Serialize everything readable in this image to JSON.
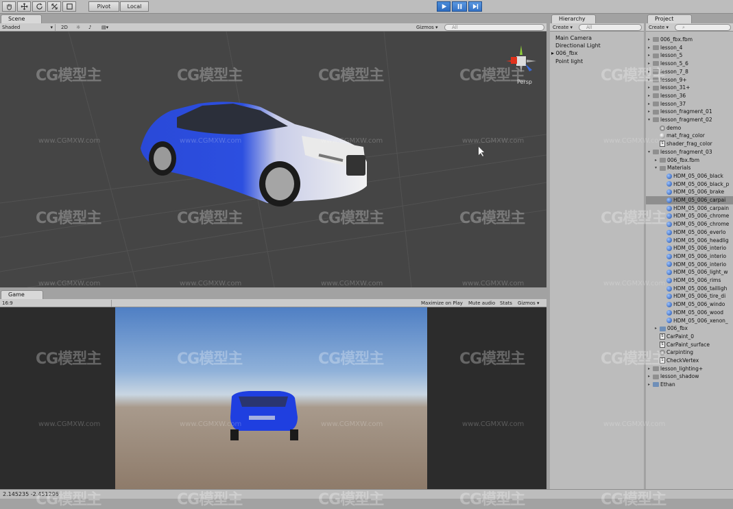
{
  "toolbar": {
    "pivot_label": "Pivot",
    "local_label": "Local"
  },
  "scene": {
    "tab_label": "Scene",
    "shading_mode": "Shaded",
    "mode_2d": "2D",
    "gizmos_label": "Gizmos",
    "search_placeholder": "All",
    "persp_label": "Persp"
  },
  "game": {
    "tab_label": "Game",
    "aspect": "16:9",
    "maximize_label": "Maximize on Play",
    "mute_label": "Mute audio",
    "stats_label": "Stats",
    "gizmos_label": "Gizmos"
  },
  "hierarchy": {
    "tab_label": "Hierarchy",
    "create_label": "Create",
    "search_placeholder": "All",
    "items": [
      "Main Camera",
      "Directional Light",
      "006_fbx",
      "Point light"
    ]
  },
  "project": {
    "tab_label": "Project",
    "create_label": "Create",
    "rows": [
      {
        "label": "006_fbx.fbm",
        "type": "folder",
        "indent": 0,
        "arrow": "right"
      },
      {
        "label": "lesson_4",
        "type": "folder",
        "indent": 0,
        "arrow": "right"
      },
      {
        "label": "lesson_5",
        "type": "folder",
        "indent": 0,
        "arrow": "right"
      },
      {
        "label": "lesson_5_6",
        "type": "folder",
        "indent": 0,
        "arrow": "right"
      },
      {
        "label": "lesson_7_8",
        "type": "folder",
        "indent": 0,
        "arrow": "right"
      },
      {
        "label": "lesson_9+",
        "type": "folder",
        "indent": 0,
        "arrow": "right"
      },
      {
        "label": "lesson_31+",
        "type": "folder",
        "indent": 0,
        "arrow": "right"
      },
      {
        "label": "lesson_36",
        "type": "folder",
        "indent": 0,
        "arrow": "right"
      },
      {
        "label": "lesson_37",
        "type": "folder",
        "indent": 0,
        "arrow": "right"
      },
      {
        "label": "lesson_fragment_01",
        "type": "folder",
        "indent": 0,
        "arrow": "right"
      },
      {
        "label": "lesson_fragment_02",
        "type": "folder",
        "indent": 0,
        "arrow": "down"
      },
      {
        "label": "demo",
        "type": "scene",
        "indent": 1,
        "arrow": ""
      },
      {
        "label": "mat_frag_color",
        "type": "material",
        "indent": 1,
        "arrow": ""
      },
      {
        "label": "shader_frag_color",
        "type": "script",
        "indent": 1,
        "arrow": ""
      },
      {
        "label": "lesson_fragment_03",
        "type": "folder",
        "indent": 0,
        "arrow": "down"
      },
      {
        "label": "006_fbx.fbm",
        "type": "folder",
        "indent": 1,
        "arrow": "right"
      },
      {
        "label": "Materials",
        "type": "folder",
        "indent": 1,
        "arrow": "down"
      },
      {
        "label": "HDM_05_006_black",
        "type": "ball",
        "indent": 2,
        "arrow": ""
      },
      {
        "label": "HDM_05_006_black_p",
        "type": "ball",
        "indent": 2,
        "arrow": ""
      },
      {
        "label": "HDM_05_006_brake",
        "type": "ball",
        "indent": 2,
        "arrow": ""
      },
      {
        "label": "HDM_05_006_carpai",
        "type": "ball",
        "indent": 2,
        "arrow": "",
        "selected": true
      },
      {
        "label": "HDM_05_006_carpain",
        "type": "ball",
        "indent": 2,
        "arrow": ""
      },
      {
        "label": "HDM_05_006_chrome",
        "type": "ball",
        "indent": 2,
        "arrow": ""
      },
      {
        "label": "HDM_05_006_chrome",
        "type": "ball",
        "indent": 2,
        "arrow": ""
      },
      {
        "label": "HDM_05_006_everlo",
        "type": "ball",
        "indent": 2,
        "arrow": ""
      },
      {
        "label": "HDM_05_006_headlig",
        "type": "ball",
        "indent": 2,
        "arrow": ""
      },
      {
        "label": "HDM_05_006_interio",
        "type": "ball",
        "indent": 2,
        "arrow": ""
      },
      {
        "label": "HDM_05_006_interio",
        "type": "ball",
        "indent": 2,
        "arrow": ""
      },
      {
        "label": "HDM_05_006_interio",
        "type": "ball",
        "indent": 2,
        "arrow": ""
      },
      {
        "label": "HDM_05_006_light_w",
        "type": "ball",
        "indent": 2,
        "arrow": ""
      },
      {
        "label": "HDM_05_006_rims",
        "type": "ball",
        "indent": 2,
        "arrow": ""
      },
      {
        "label": "HDM_05_006_tailligh",
        "type": "ball",
        "indent": 2,
        "arrow": ""
      },
      {
        "label": "HDM_05_006_tire_di",
        "type": "ball",
        "indent": 2,
        "arrow": ""
      },
      {
        "label": "HDM_05_006_windo",
        "type": "ball",
        "indent": 2,
        "arrow": ""
      },
      {
        "label": "HDM_05_006_wood",
        "type": "ball",
        "indent": 2,
        "arrow": ""
      },
      {
        "label": "HDM_05_006_xenon_",
        "type": "ball",
        "indent": 2,
        "arrow": ""
      },
      {
        "label": "006_fbx",
        "type": "model",
        "indent": 1,
        "arrow": "right"
      },
      {
        "label": "CarPaint_0",
        "type": "script",
        "indent": 1,
        "arrow": ""
      },
      {
        "label": "CarPaint_surface",
        "type": "script",
        "indent": 1,
        "arrow": ""
      },
      {
        "label": "Carpinting",
        "type": "scene",
        "indent": 1,
        "arrow": ""
      },
      {
        "label": "CheckVertex",
        "type": "script",
        "indent": 1,
        "arrow": ""
      },
      {
        "label": "lesson_lighting+",
        "type": "folder",
        "indent": 0,
        "arrow": "right"
      },
      {
        "label": "lesson_shadow",
        "type": "folder",
        "indent": 0,
        "arrow": "right"
      },
      {
        "label": "Ethan",
        "type": "model",
        "indent": 0,
        "arrow": "right"
      }
    ]
  },
  "status": {
    "text": "2.145235   -2.451296"
  },
  "watermark": {
    "logo": "CG模型主",
    "url": "www.CGMXW.com"
  }
}
